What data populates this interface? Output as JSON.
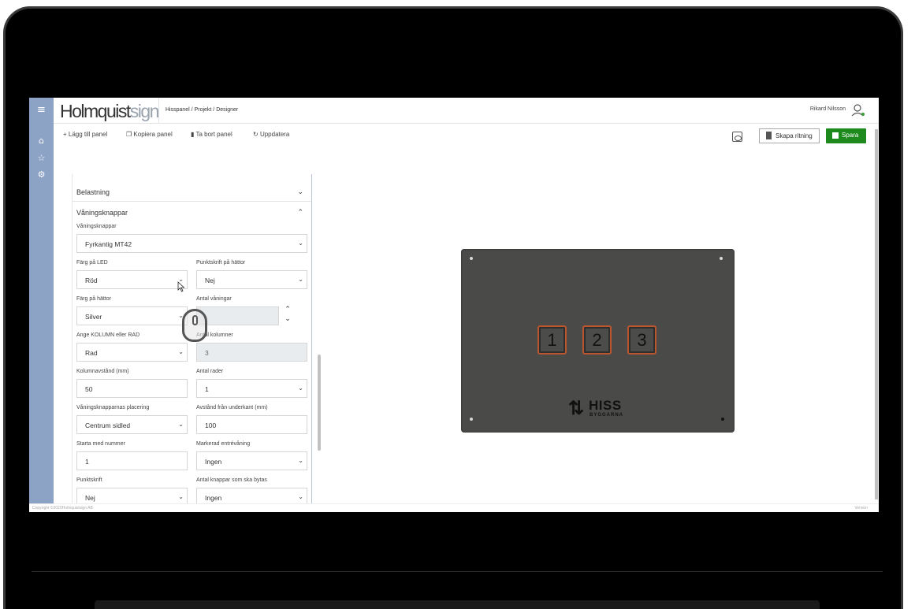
{
  "header": {
    "logo_main": "Holmquist",
    "logo_tail": "sign",
    "breadcrumb": "Hisspanel / Projekt / Designer",
    "user_name": "Rikard Nilsson"
  },
  "nav": {
    "menu_icon": "≡",
    "home_icon": "⌂",
    "star_icon": "☆",
    "gear_icon": "⚙"
  },
  "toolbar": {
    "add_panel": "+ Lägg till panel",
    "copy_panel": "Kopiera panel",
    "delete_panel": "Ta bort panel",
    "refresh": "Uppdatera",
    "create_drawing": "Skapa ritning",
    "save": "Spara"
  },
  "panel": {
    "section_load": "Belastning",
    "section_buttons": "Våningsknappar",
    "fields": {
      "button_type_label": "Våningsknappar",
      "button_type_value": "Fyrkantig MT42",
      "led_color_label": "Färg på LED",
      "led_color_value": "Röd",
      "braille_caps_label": "Punktskrift på hättor",
      "braille_caps_value": "Nej",
      "cap_color_label": "Färg på hättor",
      "cap_color_value": "Silver",
      "floors_label": "Antal våningar",
      "floors_value": "",
      "column_or_row_label": "Ange KOLUMN eller RAD",
      "column_or_row_value": "Rad",
      "columns_label": "Antal kolumner",
      "columns_value": "3",
      "column_spacing_label": "Kolumnavstånd (mm)",
      "column_spacing_value": "50",
      "rows_label": "Antal rader",
      "rows_value": "1",
      "placement_label": "Våningsknapparnas placering",
      "placement_value": "Centrum sidled",
      "distance_bottom_label": "Avstånd från underkant (mm)",
      "distance_bottom_value": "100",
      "start_number_label": "Starta med nummer",
      "start_number_value": "1",
      "marked_entry_label": "Markerad entrévåning",
      "marked_entry_value": "Ingen",
      "braille_label": "Punktskrift",
      "braille_value": "Nej",
      "buttons_replaced_label": "Antal knappar som ska bytas",
      "buttons_replaced_value": "Ingen"
    }
  },
  "preview": {
    "buttons": [
      "1",
      "2",
      "3"
    ],
    "plate_color": "#4a4a48",
    "led_border_color": "#b9552f",
    "brand_main": "HISS",
    "brand_sub": "BYGGARNA"
  },
  "footer": {
    "copyright": "Copyright ©2020Holmquistsign AB",
    "version": "Version"
  }
}
